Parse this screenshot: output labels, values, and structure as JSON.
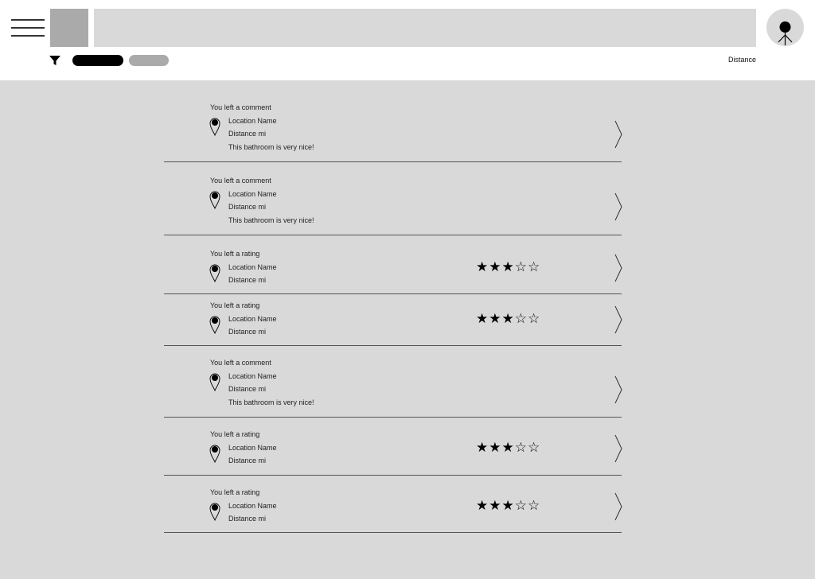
{
  "header": {
    "sort_label": "Distance"
  },
  "activities": [
    {
      "type_label": "You left a comment",
      "location_name": "Location Name",
      "distance": "Distance mi",
      "comment": "This bathroom is very nice!"
    },
    {
      "type_label": "You left a comment",
      "location_name": "Location Name",
      "distance": "Distance mi",
      "comment": "This bathroom is very nice!"
    },
    {
      "type_label": "You left a rating",
      "location_name": "Location Name",
      "distance": "Distance mi",
      "rating": 3,
      "rating_max": 5,
      "stars": "★★★☆☆"
    },
    {
      "type_label": "You left a rating",
      "location_name": "Location Name",
      "distance": "Distance mi",
      "rating": 3,
      "rating_max": 5,
      "stars": "★★★☆☆"
    },
    {
      "type_label": "You left a comment",
      "location_name": "Location Name",
      "distance": "Distance mi",
      "comment": "This bathroom is very nice!"
    },
    {
      "type_label": "You left a rating",
      "location_name": "Location Name",
      "distance": "Distance mi",
      "rating": 3,
      "rating_max": 5,
      "stars": "★★★☆☆"
    },
    {
      "type_label": "You left a rating",
      "location_name": "Location Name",
      "distance": "Distance mi",
      "rating": 3,
      "rating_max": 5,
      "stars": "★★★☆☆"
    }
  ],
  "icons": {
    "menu": "hamburger-menu-icon",
    "filter": "filter-icon",
    "pin": "location-pin-icon",
    "chevron": "chevron-right-icon",
    "avatar": "user-avatar-icon"
  }
}
